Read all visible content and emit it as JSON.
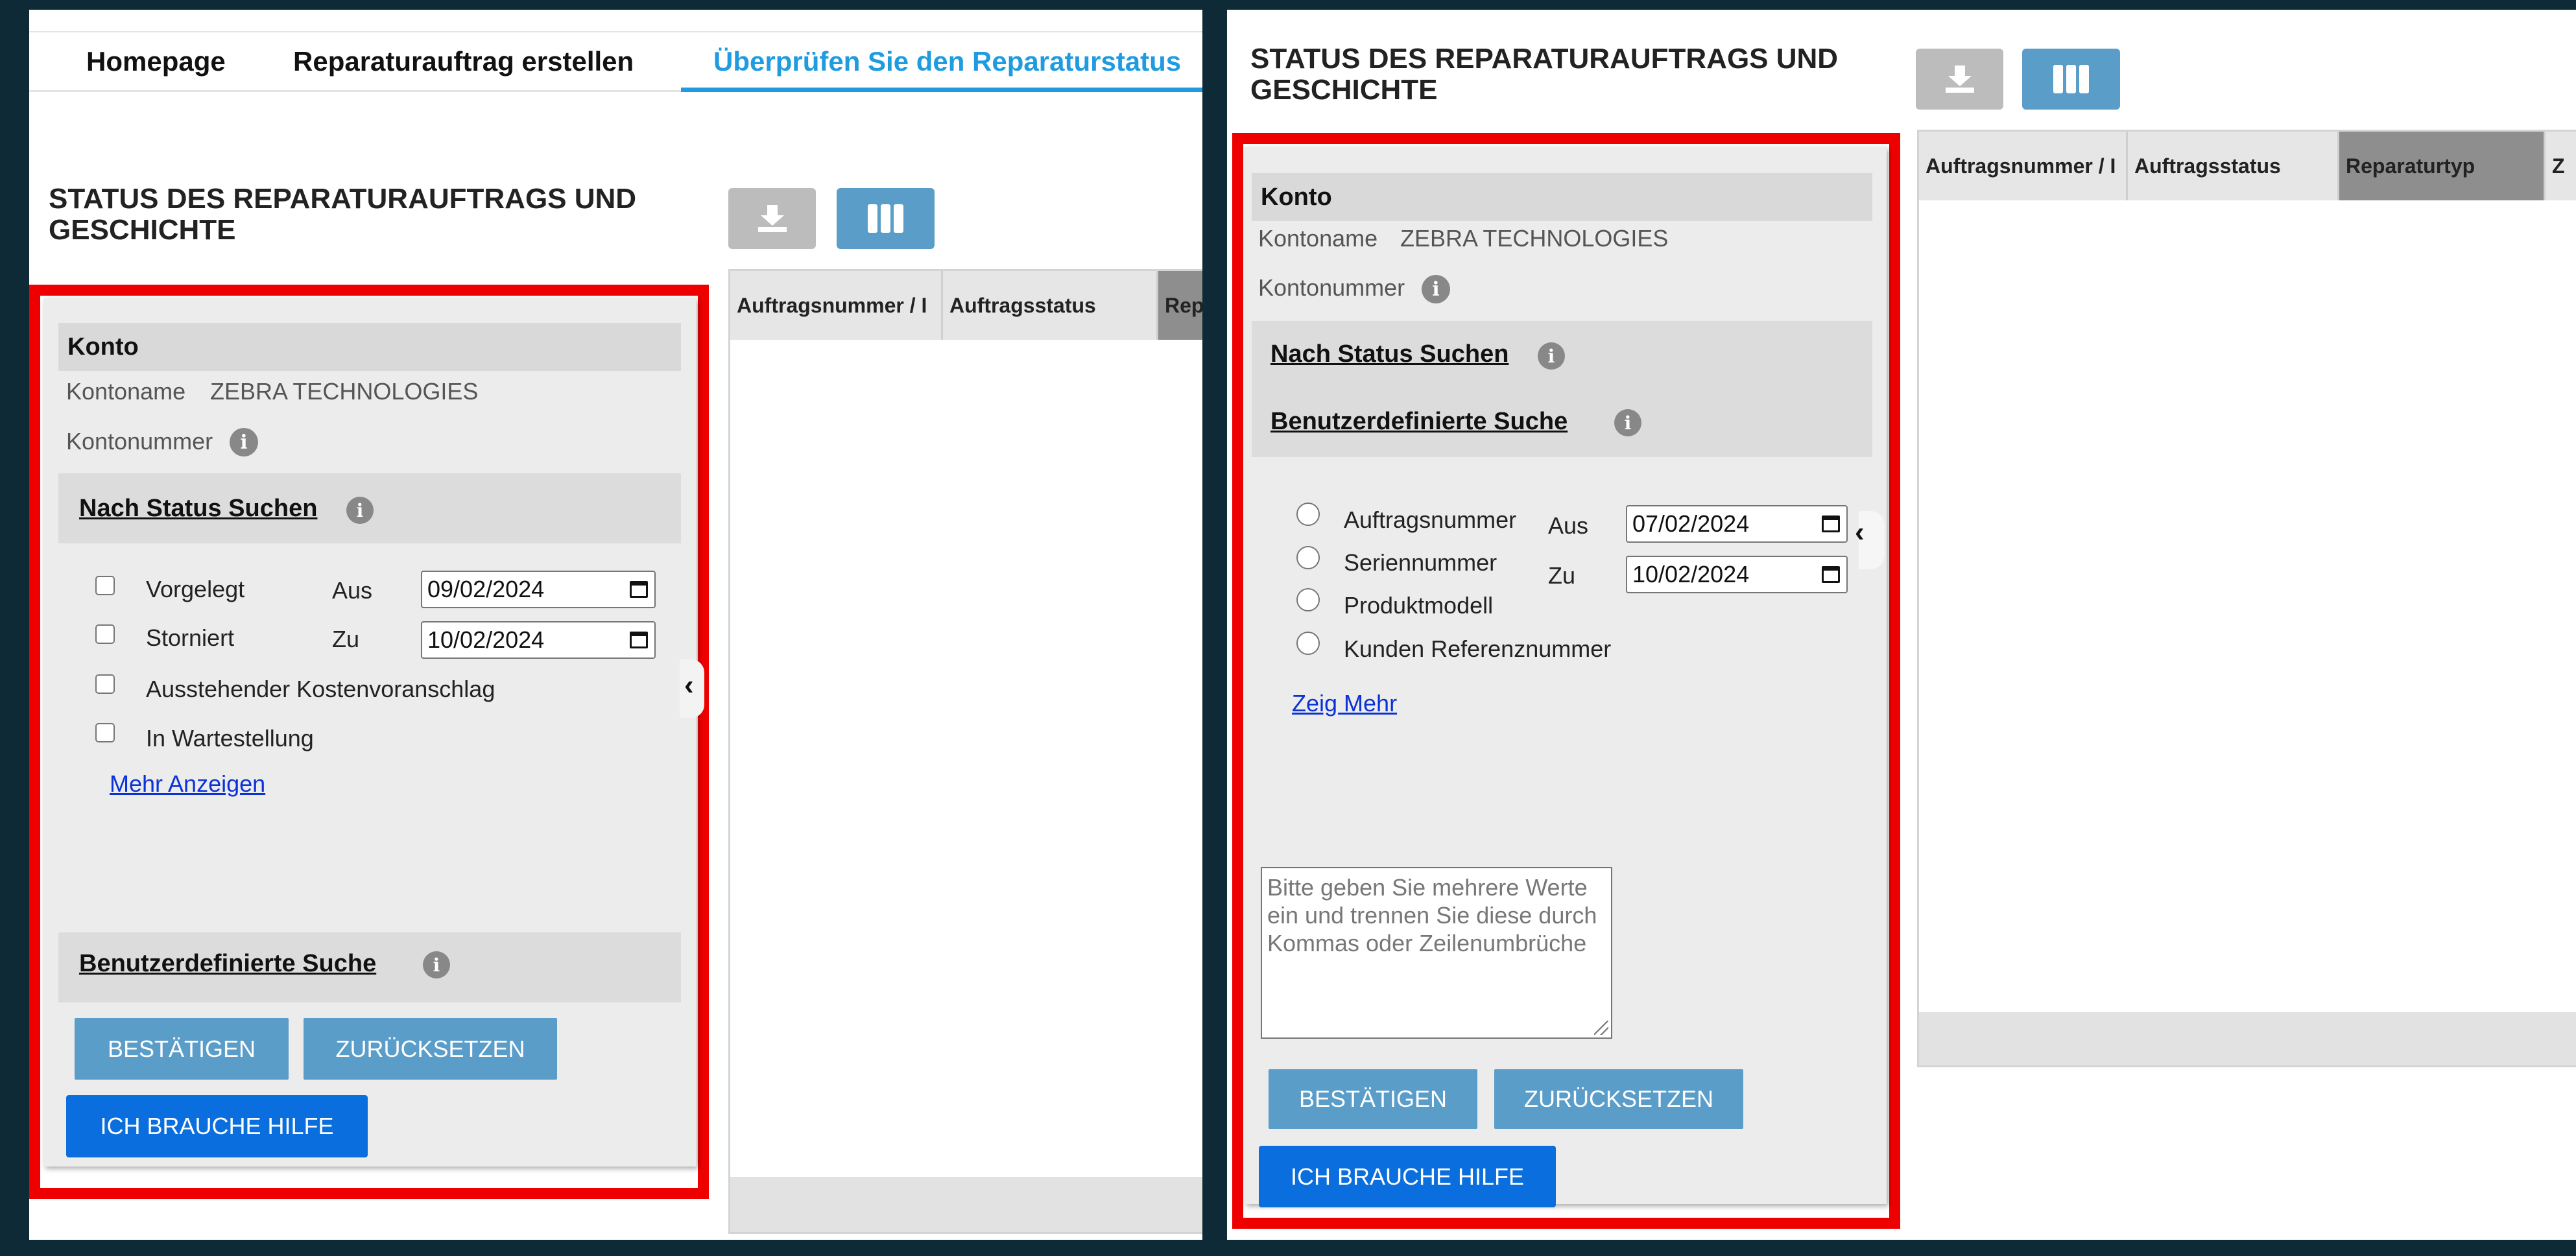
{
  "nav": {
    "items": [
      "Homepage",
      "Reparaturauftrag erstellen",
      "Überprüfen Sie den Reparaturstatus"
    ],
    "active_color": "#1f9be0"
  },
  "page_title_line1": "STATUS DES REPARATURAUFTRAGS UND",
  "page_title_line2": "GESCHICHTE",
  "table_headers": [
    "Auftragsnummer / I",
    "Auftragsstatus",
    "Reparaturtyp",
    "Rep",
    "Z"
  ],
  "panel": {
    "konto_heading": "Konto",
    "account_name_label": "Kontoname",
    "account_name_value": "ZEBRA TECHNOLOGIES",
    "account_number_label": "Kontonummer",
    "search_by_status": "Nach Status Suchen",
    "custom_search": "Benutzerdefinierte Suche",
    "confirm": "BESTÄTIGEN",
    "reset": "ZURÜCKSETZEN",
    "help": "ICH BRAUCHE HILFE",
    "from_label": "Aus",
    "to_label": "Zu"
  },
  "left": {
    "statuses": [
      "Vorgelegt",
      "Storniert",
      "Ausstehender Kostenvoranschlag",
      "In Wartestellung"
    ],
    "show_more": "Mehr Anzeigen",
    "from_date": "09/02/2024",
    "to_date": "10/02/2024"
  },
  "right": {
    "search_types": [
      "Auftragsnummer",
      "Seriennummer",
      "Produktmodell",
      "Kunden Referenznummer"
    ],
    "show_more": "Zeig Mehr",
    "from_date": "07/02/2024",
    "to_date": "10/02/2024",
    "textarea_placeholder": "Bitte geben Sie mehrere Werte ein und trennen Sie diese durch Kommas oder Zeilenumbrüche"
  },
  "colors": {
    "highlight_frame": "#ee0000",
    "button_blue": "#5a9dc9",
    "help_blue": "#0a6ede",
    "link_blue": "#0b32d6"
  },
  "icons": [
    "download-icon",
    "columns-icon",
    "info-icon",
    "calendar-icon",
    "chevron-left-icon"
  ]
}
